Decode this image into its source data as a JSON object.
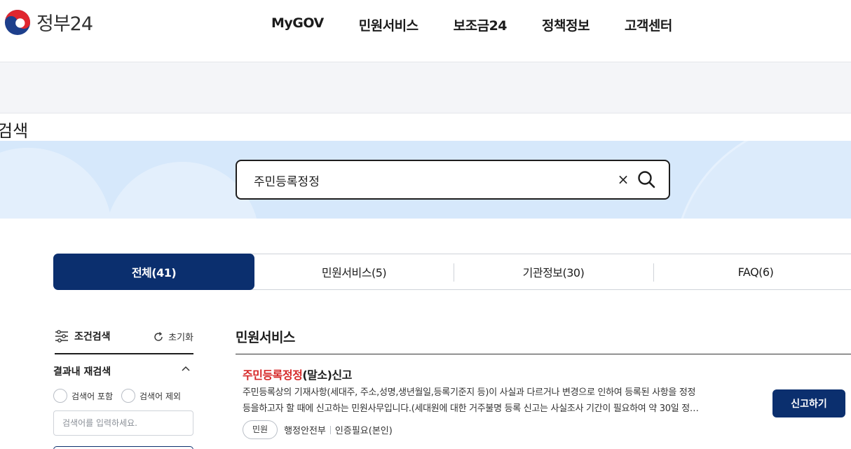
{
  "header": {
    "logo_text": "정부24",
    "nav": [
      "MyGOV",
      "민원서비스",
      "보조금24",
      "정책정보",
      "고객센터"
    ]
  },
  "page": {
    "title": "검색"
  },
  "search": {
    "query": "주민등록정정",
    "clear_label": "×"
  },
  "tabs": [
    {
      "label": "전체(41)",
      "active": true
    },
    {
      "label": "민원서비스(5)",
      "active": false
    },
    {
      "label": "기관정보(30)",
      "active": false
    },
    {
      "label": "FAQ(6)",
      "active": false
    }
  ],
  "sidebar": {
    "filter_title": "조건검색",
    "reset_label": "초기화",
    "refine_label": "결과내 재검색",
    "radio_include": "검색어 포함",
    "radio_exclude": "검색어 제외",
    "refine_placeholder": "검색어를 입력하세요."
  },
  "results": {
    "section_title": "민원서비스",
    "items": [
      {
        "title_highlight": "주민등록정정",
        "title_rest": "(말소)신고",
        "desc_line1": "주민등록상의 기재사항(세대주, 주소,성명,생년월일,등록기준지 등)이 사실과 다르거나 변경으로 인하여 등록된 사항을 정정",
        "desc_line2": "등을하고자 할 때에 신고하는 민원사무입니다.(세대원에 대한 거주불명 등록 신고는 사실조사 기간이 필요하여 약 30일 정…",
        "chip": "민원",
        "agency": "행정안전부",
        "auth": "인증필요(본인)",
        "action_label": "신고하기"
      }
    ]
  },
  "colors": {
    "primary": "#0b2f6e",
    "highlight": "#d62929",
    "search_band": "#d6e8fb"
  }
}
